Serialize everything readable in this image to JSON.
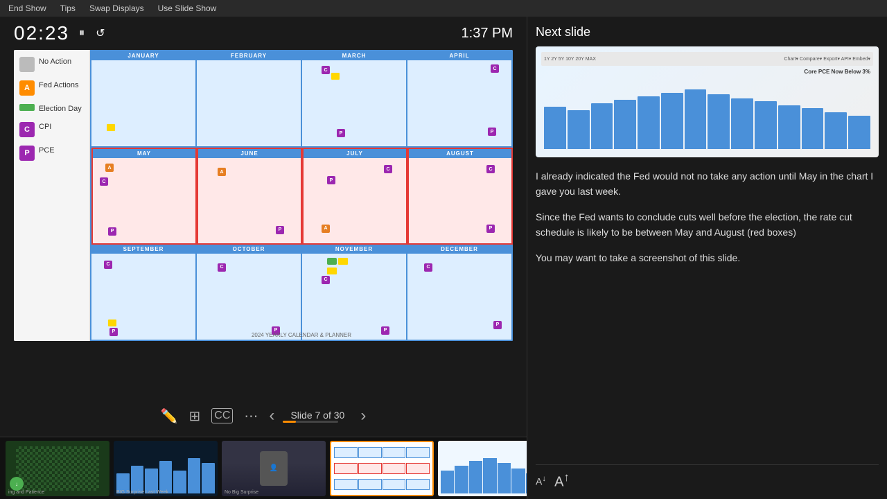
{
  "menubar": {
    "items": [
      "End Show",
      "Tips",
      "Swap Displays",
      "Use Slide Show"
    ]
  },
  "timer": {
    "display": "02:23",
    "clock": "1:37 PM"
  },
  "slide": {
    "current": 7,
    "total": 30,
    "label": "Slide 7 of 30",
    "footer": "2024 YEARLY CALENDAR & PLANNER"
  },
  "legend": {
    "items": [
      {
        "id": "no-action",
        "badge": "",
        "color": "#ccc",
        "text": "No Action"
      },
      {
        "id": "fed-actions",
        "badge": "A",
        "color": "#e67e22",
        "text": "Fed Actions"
      },
      {
        "id": "election-day",
        "badge": "",
        "color": "#4caf50",
        "text": "Election Day"
      },
      {
        "id": "cpi",
        "badge": "C",
        "color": "#9c27b0",
        "text": "CPI"
      },
      {
        "id": "pce",
        "badge": "P",
        "color": "#9c27b0",
        "text": "PCE"
      }
    ]
  },
  "right_panel": {
    "header": "Next slide",
    "notes": [
      "I already indicated the Fed would not no take any action until May in the chart I gave you last week.",
      "Since the Fed wants to conclude cuts well before the election, the rate cut schedule is likely to be between May and August (red boxes)",
      "You may want to take a screenshot of this slide."
    ]
  },
  "font_controls": {
    "decrease_label": "A",
    "increase_label": "A"
  },
  "months": [
    "JANUARY",
    "FEBRUARY",
    "MARCH",
    "APRIL",
    "MAY",
    "JUNE",
    "JULY",
    "AUGUST",
    "SEPTEMBER",
    "OCTOBER",
    "NOVEMBER",
    "DECEMBER"
  ],
  "thumbnails": [
    {
      "id": "thumb-1",
      "label": "ing and Patience",
      "type": "chess"
    },
    {
      "id": "thumb-2",
      "label": "BIG Surprise Last Week",
      "type": "chart-dark"
    },
    {
      "id": "thumb-3",
      "label": "No Big Surprise",
      "type": "person"
    },
    {
      "id": "thumb-4",
      "label": "",
      "type": "calendar-active"
    },
    {
      "id": "thumb-5",
      "label": "",
      "type": "chart-blue"
    },
    {
      "id": "thumb-6",
      "label": "",
      "type": "chart-blue2"
    },
    {
      "id": "thumb-7",
      "label": "",
      "type": "chart-blue3"
    }
  ],
  "colors": {
    "accent": "#ff8c00",
    "primary": "#4a90d9",
    "red": "#e53935",
    "green": "#4caf50",
    "purple": "#9c27b0",
    "yellow": "#ffd700",
    "orange": "#e67e22"
  },
  "mini_chart": {
    "title": "Core PCE Now Below 3%",
    "bars": [
      60,
      55,
      65,
      70,
      75,
      80,
      85,
      78,
      72,
      68,
      62,
      58,
      52,
      48
    ]
  }
}
